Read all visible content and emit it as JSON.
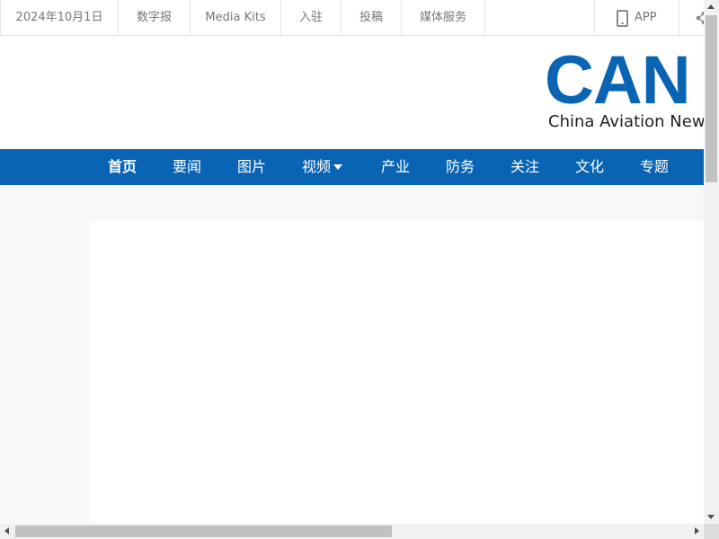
{
  "topbar": {
    "date": "2024年10月1日",
    "links": [
      "数字报",
      "Media Kits",
      "入驻",
      "投稿",
      "媒体服务"
    ],
    "app_label": "APP",
    "app_icon": "phone-icon",
    "share_icon": "share-icon"
  },
  "header": {
    "logo_text": "CAN",
    "logo_subtitle": "China Aviation New"
  },
  "nav": {
    "items": [
      "首页",
      "要闻",
      "图片",
      "视频",
      "产业",
      "防务",
      "关注",
      "文化",
      "专题"
    ],
    "active": "首页",
    "dropdown_item": "视频"
  },
  "colors": {
    "brand_blue": "#0a64b4",
    "text_gray": "#777777",
    "border_gray": "#e6e6e6",
    "page_bg": "#f8f8f8"
  }
}
